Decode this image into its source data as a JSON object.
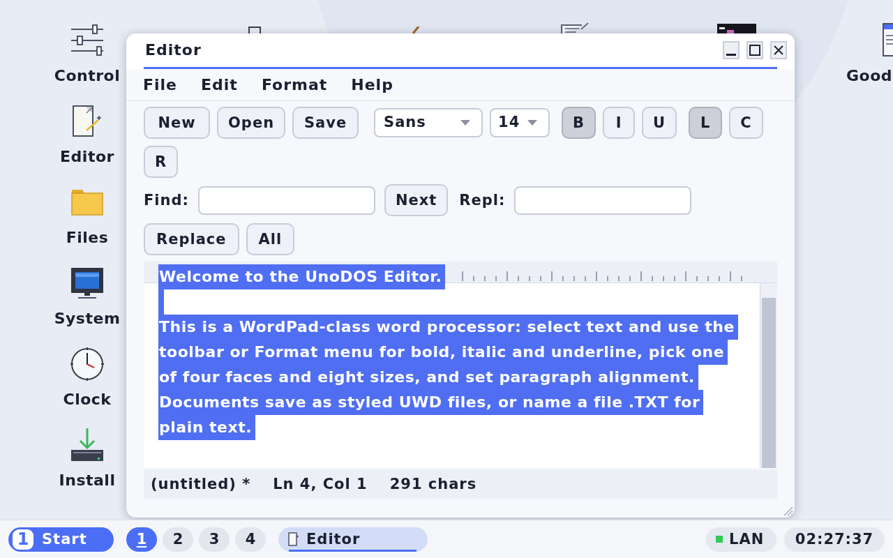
{
  "desktop_icons": [
    {
      "label": "Control",
      "kind": "sliders"
    },
    {
      "label": "Editor",
      "kind": "editor"
    },
    {
      "label": "Files",
      "kind": "folder"
    },
    {
      "label": "System",
      "kind": "monitor"
    },
    {
      "label": "Clock",
      "kind": "clock"
    },
    {
      "label": "Install",
      "kind": "install"
    }
  ],
  "desktop_icons_right": [
    {
      "label": "Good",
      "kind": "document"
    }
  ],
  "window": {
    "title": "Editor"
  },
  "menu": [
    "File",
    "Edit",
    "Format",
    "Help"
  ],
  "toolbar": {
    "file_buttons": [
      "New",
      "Open",
      "Save"
    ],
    "font": {
      "value": "Sans"
    },
    "size": {
      "value": "14"
    },
    "style_toggles": [
      {
        "label": "B",
        "on": true
      },
      {
        "label": "I",
        "on": false
      },
      {
        "label": "U",
        "on": false
      }
    ],
    "align_buttons": [
      {
        "label": "L",
        "selected": true
      },
      {
        "label": "C",
        "selected": false
      },
      {
        "label": "R",
        "selected": false
      }
    ]
  },
  "find_bar": {
    "find_label": "Find:",
    "next_button": "Next",
    "replace_label": "Repl:",
    "replace_button": "Replace",
    "all_button": "All"
  },
  "document": {
    "paragraphs": [
      {
        "lines": [
          "Welcome to the UnoDOS Editor."
        ],
        "selected": true
      },
      {
        "lines": [
          "This is a WordPad-class word processor: select text and use the",
          "toolbar or Format menu for bold, italic and underline, pick one",
          "of four faces and eight sizes, and set paragraph alignment.",
          "Documents save as styled UWD files, or name a file .TXT for",
          "plain text."
        ],
        "selected": true
      }
    ]
  },
  "status_bar": [
    "(untitled) *",
    "Ln 4, Col 1",
    "291 chars"
  ],
  "taskbar": {
    "start": {
      "logo": "1",
      "label": "Start"
    },
    "workspaces": [
      {
        "label": "1",
        "selected": true
      },
      {
        "label": "2",
        "selected": false
      },
      {
        "label": "3",
        "selected": false
      },
      {
        "label": "4",
        "selected": false
      }
    ],
    "tasks": [
      {
        "label": "Editor",
        "active": true
      }
    ],
    "network": {
      "label": "LAN",
      "connected": true
    },
    "clock": "02:27:37"
  }
}
